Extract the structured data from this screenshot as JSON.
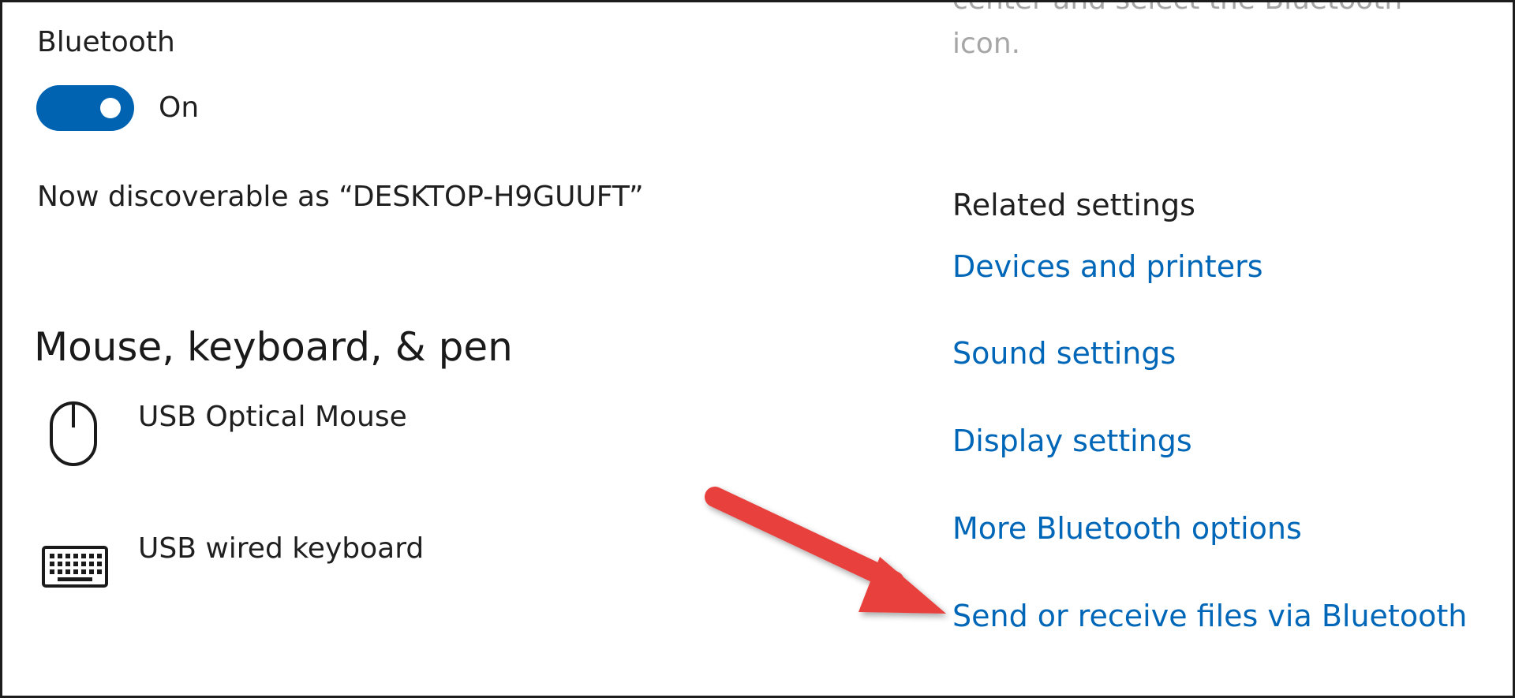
{
  "bluetooth": {
    "label": "Bluetooth",
    "toggle_state": "On",
    "discoverable_text": "Now discoverable as “DESKTOP-H9GUUFT”"
  },
  "help_text": {
    "line1": "center and select the Bluetooth",
    "line2": "icon."
  },
  "devices": {
    "heading": "Mouse, keyboard, & pen",
    "items": [
      {
        "name": "USB Optical Mouse",
        "icon": "mouse-icon"
      },
      {
        "name": "USB wired keyboard",
        "icon": "keyboard-icon"
      }
    ]
  },
  "related": {
    "heading": "Related settings",
    "links": [
      "Devices and printers",
      "Sound settings",
      "Display settings",
      "More Bluetooth options",
      "Send or receive files via Bluetooth"
    ]
  },
  "colors": {
    "accent": "#0063b1",
    "link": "#0067b8",
    "annotation_arrow": "#e8413e"
  }
}
